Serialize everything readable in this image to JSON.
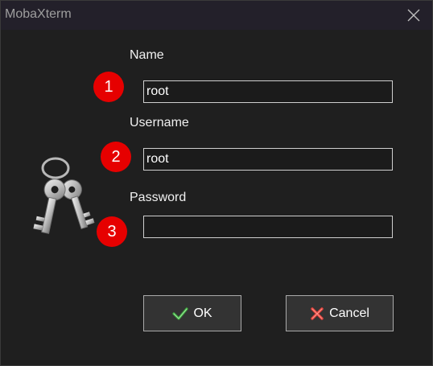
{
  "window": {
    "title": "MobaXterm",
    "close_icon": "close-icon"
  },
  "form": {
    "name_label": "Name",
    "name_value": "root",
    "username_label": "Username",
    "username_value": "root",
    "password_label": "Password",
    "password_value": ""
  },
  "badges": [
    "1",
    "2",
    "3"
  ],
  "buttons": {
    "ok_label": "OK",
    "cancel_label": "Cancel"
  },
  "colors": {
    "badge": "#e60000",
    "ok_check": "#3ca83c",
    "cancel_x": "#e0403a"
  },
  "icons": {
    "keys": "keys-icon",
    "ok": "checkmark-icon",
    "cancel": "cross-icon"
  }
}
